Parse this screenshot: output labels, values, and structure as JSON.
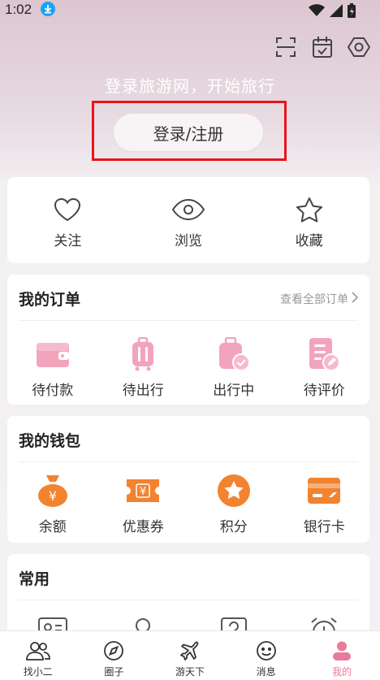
{
  "status_bar": {
    "time": "1:02"
  },
  "header": {
    "login_prompt": "登录旅游网，开始旅行",
    "login_button": "登录/注册"
  },
  "favorites": [
    {
      "label": "关注",
      "icon": "heart-icon"
    },
    {
      "label": "浏览",
      "icon": "eye-icon"
    },
    {
      "label": "收藏",
      "icon": "star-icon"
    }
  ],
  "orders": {
    "title": "我的订单",
    "view_all": "查看全部订单",
    "items": [
      {
        "label": "待付款",
        "icon": "wallet-icon"
      },
      {
        "label": "待出行",
        "icon": "luggage-icon"
      },
      {
        "label": "出行中",
        "icon": "suitcase-check-icon"
      },
      {
        "label": "待评价",
        "icon": "review-icon"
      }
    ]
  },
  "wallet": {
    "title": "我的钱包",
    "items": [
      {
        "label": "余额",
        "icon": "money-bag-icon"
      },
      {
        "label": "优惠券",
        "icon": "coupon-icon"
      },
      {
        "label": "积分",
        "icon": "points-icon"
      },
      {
        "label": "银行卡",
        "icon": "bank-card-icon"
      }
    ]
  },
  "common": {
    "title": "常用",
    "items": [
      {
        "icon": "id-card-icon"
      },
      {
        "icon": "contact-icon"
      },
      {
        "icon": "help-icon"
      },
      {
        "icon": "alarm-icon"
      }
    ]
  },
  "bottom_nav": [
    {
      "label": "找小二",
      "icon": "people-icon"
    },
    {
      "label": "圈子",
      "icon": "compass-icon"
    },
    {
      "label": "游天下",
      "icon": "plane-icon"
    },
    {
      "label": "消息",
      "icon": "smile-icon"
    },
    {
      "label": "我的",
      "icon": "user-icon",
      "active": true
    }
  ],
  "colors": {
    "accent": "#e97a9c",
    "highlight": "#e8141c",
    "icon_pink": "#ef8fae",
    "icon_orange": "#f2832f"
  }
}
